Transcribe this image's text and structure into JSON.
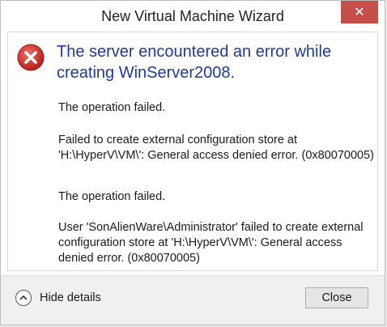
{
  "window": {
    "title": "New Virtual Machine Wizard",
    "close_glyph": "✕"
  },
  "error": {
    "icon": "error-icon",
    "heading": "The server encountered an error while creating WinServer2008.",
    "messages": [
      "The operation failed.",
      "Failed to create external configuration store at 'H:\\HyperV\\VM\\': General access denied error. (0x80070005)",
      "The operation failed.",
      "User 'SonAlienWare\\Administrator' failed to create external configuration store at 'H:\\HyperV\\VM\\': General access denied error. (0x80070005)"
    ]
  },
  "footer": {
    "details_label": "Hide details",
    "details_icon": "chevron-up-icon",
    "close_label": "Close"
  },
  "colors": {
    "heading": "#1f3b99",
    "error_red": "#d0312d",
    "titlebar_close": "#c74f4a"
  }
}
